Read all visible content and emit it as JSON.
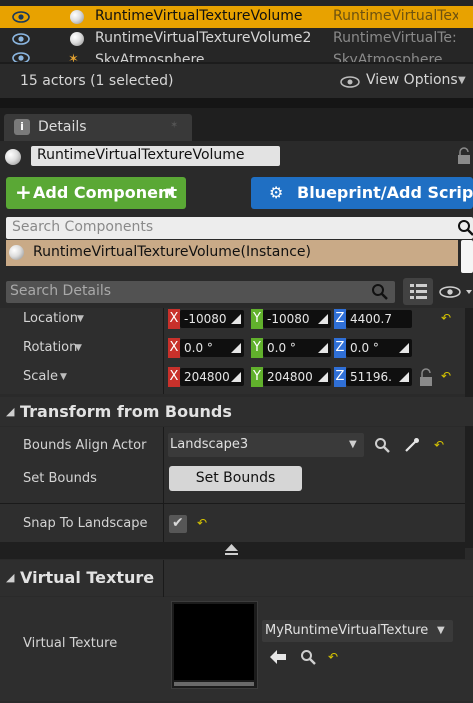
{
  "outliner": {
    "rows": [
      {
        "name": "RuntimeVirtualTextureVolume",
        "type": "RuntimeVirtualTex"
      },
      {
        "name": "RuntimeVirtualTextureVolume2",
        "type": "RuntimeVirtualTe:"
      },
      {
        "name": "SkyAtmosphere",
        "type": "SkyAtmosphere"
      }
    ],
    "status": "15 actors (1 selected)",
    "view_options": "View Options"
  },
  "details": {
    "tab_label": "Details",
    "actor_name": "RuntimeVirtualTextureVolume",
    "add_component": "Add Component",
    "blueprint_script": "Blueprint/Add Script",
    "search_components_placeholder": "Search Components",
    "component_instance": "RuntimeVirtualTextureVolume(Instance)",
    "search_details_placeholder": "Search Details"
  },
  "transform": {
    "location": {
      "label": "Location",
      "x": "-10080",
      "y": "-10080",
      "z": "4400.7"
    },
    "rotation": {
      "label": "Rotation",
      "x": "0.0 °",
      "y": "0.0 °",
      "z": "0.0 °"
    },
    "scale": {
      "label": "Scale",
      "x": "204800",
      "y": "204800",
      "z": "51196."
    }
  },
  "transform_from_bounds": {
    "title": "Transform from Bounds",
    "bounds_align_actor_label": "Bounds Align Actor",
    "bounds_align_actor_value": "Landscape3",
    "set_bounds_label": "Set Bounds",
    "set_bounds_button": "Set Bounds",
    "snap_to_landscape_label": "Snap To Landscape",
    "snap_to_landscape_checked": true
  },
  "virtual_texture": {
    "title": "Virtual Texture",
    "label": "Virtual Texture",
    "asset": "MyRuntimeVirtualTexture"
  },
  "colors": {
    "selected_row": "#e8a200",
    "add_component_bg": "#5aa835",
    "blueprint_bg": "#1f6fc3",
    "component_row_bg": "#c9aa87",
    "axis_x": "#c8312b",
    "axis_y": "#61b12c",
    "axis_z": "#2f6fd6",
    "reset_arrow": "#d8c600"
  }
}
